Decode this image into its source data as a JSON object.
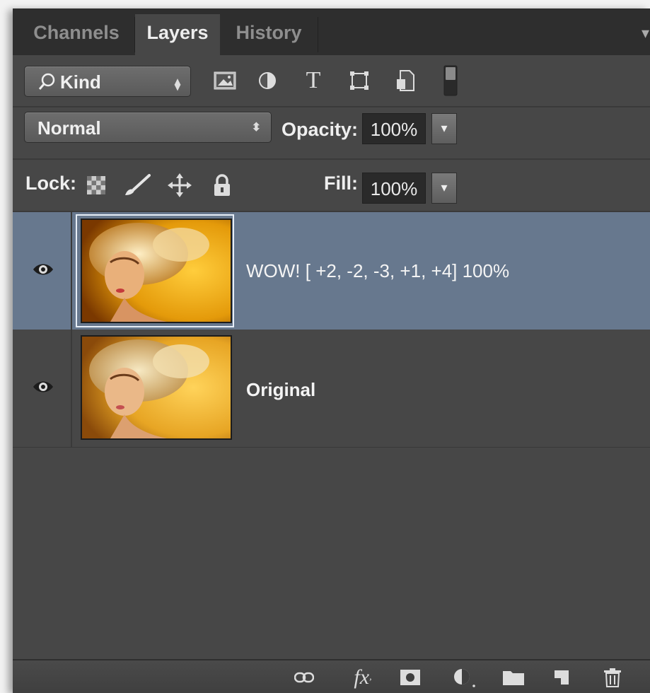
{
  "tabs": {
    "channels": "Channels",
    "layers": "Layers",
    "history": "History"
  },
  "filter": {
    "kind_label": "Kind",
    "icons": [
      "pixel-layer-filter-icon",
      "adjustment-layer-filter-icon",
      "type-layer-filter-icon",
      "shape-layer-filter-icon",
      "smart-object-filter-icon",
      "filter-toggle-switch"
    ]
  },
  "blend": {
    "mode": "Normal",
    "opacity_label": "Opacity:",
    "opacity_value": "100%"
  },
  "lock": {
    "label": "Lock:",
    "fill_label": "Fill:",
    "fill_value": "100%",
    "icons": [
      "lock-transparent-pixels-icon",
      "lock-image-pixels-icon",
      "lock-position-icon",
      "lock-all-icon"
    ]
  },
  "layers": [
    {
      "name": "WOW! [ +2, -2, -3, +1, +4] 100%",
      "selected": true,
      "visible": true
    },
    {
      "name": "Original",
      "selected": false,
      "visible": true
    }
  ],
  "bottom_icons": [
    "link-layers-icon",
    "fx-icon",
    "layer-mask-icon",
    "adjustment-layer-icon",
    "folder-icon",
    "new-layer-icon",
    "trash-icon"
  ],
  "colors": {
    "panel_bg": "#474747",
    "selected_layer": "#67788e",
    "tab_bar": "#2e2e2e"
  }
}
